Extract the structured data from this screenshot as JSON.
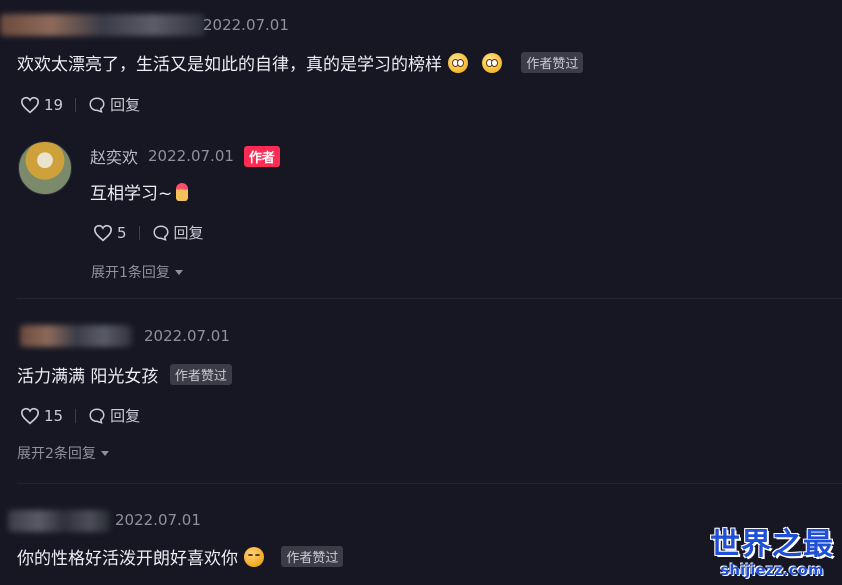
{
  "comments": [
    {
      "date": "2022.07.01",
      "text": "欢欢太漂亮了，生活又是如此的自律，真的是学习的榜样",
      "emojis": [
        "flushed-emoji",
        "flushed-emoji"
      ],
      "liked_badge": "作者赞过",
      "likes": "19",
      "reply_label": "回复",
      "reply": {
        "username": "赵奕欢",
        "date": "2022.07.01",
        "author_tag": "作者",
        "text": "互相学习~",
        "emoji": "finger-heart-emoji",
        "likes": "5",
        "reply_label": "回复"
      },
      "expand_label": "展开1条回复"
    },
    {
      "date": "2022.07.01",
      "text": "活力满满 阳光女孩",
      "liked_badge": "作者赞过",
      "likes": "15",
      "reply_label": "回复",
      "expand_label": "展开2条回复"
    },
    {
      "date": "2022.07.01",
      "text": "你的性格好活泼开朗好喜欢你",
      "emoji": "kiss-emoji",
      "liked_badge": "作者赞过"
    }
  ],
  "watermark": {
    "title": "世界之最",
    "url": "shijiezz.com"
  },
  "colors": {
    "background": "#161723",
    "author_tag": "#fe2c55",
    "watermark": "#1f4fd6"
  }
}
